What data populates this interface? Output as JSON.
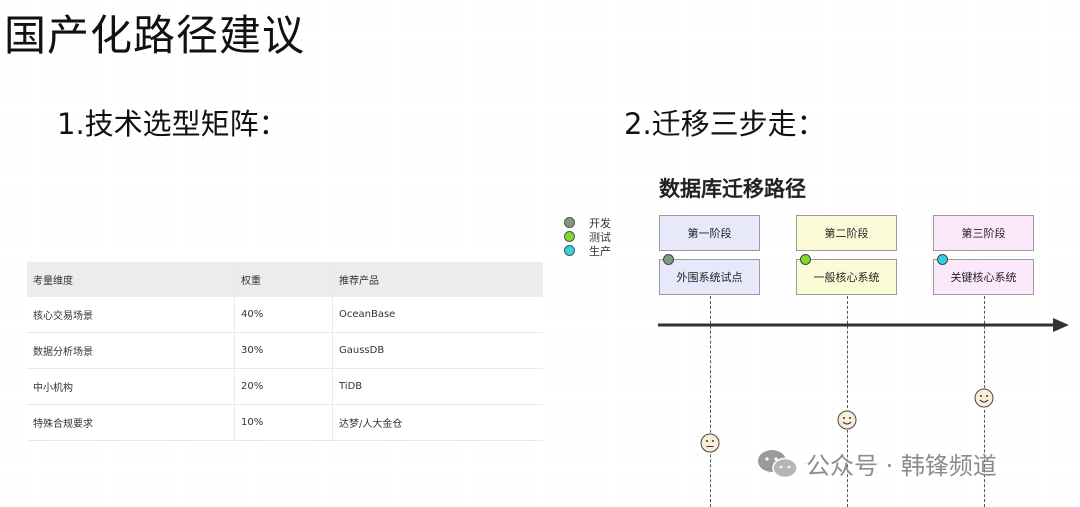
{
  "title": "国产化路径建议",
  "section1": {
    "heading": "1.技术选型矩阵："
  },
  "section2": {
    "heading": "2.迁移三步走："
  },
  "table": {
    "headers": [
      "考量维度",
      "权重",
      "推荐产品"
    ],
    "rows": [
      [
        "核心交易场景",
        "40%",
        "OceanBase"
      ],
      [
        "数据分析场景",
        "30%",
        "GaussDB"
      ],
      [
        "中小机构",
        "20%",
        "TiDB"
      ],
      [
        "特殊合规要求",
        "10%",
        "达梦/人大金仓"
      ]
    ]
  },
  "diagram": {
    "title": "数据库迁移路径",
    "legend": [
      {
        "label": "开发",
        "color": "#7f9a7f"
      },
      {
        "label": "测试",
        "color": "#7cdc2c"
      },
      {
        "label": "生产",
        "color": "#2fd3e0"
      }
    ],
    "stages": [
      {
        "name": "第一阶段",
        "system": "外围系统试点",
        "fill": "#e8e8fb"
      },
      {
        "name": "第二阶段",
        "system": "一般核心系统",
        "fill": "#fbfbd8"
      },
      {
        "name": "第三阶段",
        "system": "关键核心系统",
        "fill": "#fbe8fb"
      }
    ]
  },
  "watermark": "公众号 · 韩锋频道"
}
